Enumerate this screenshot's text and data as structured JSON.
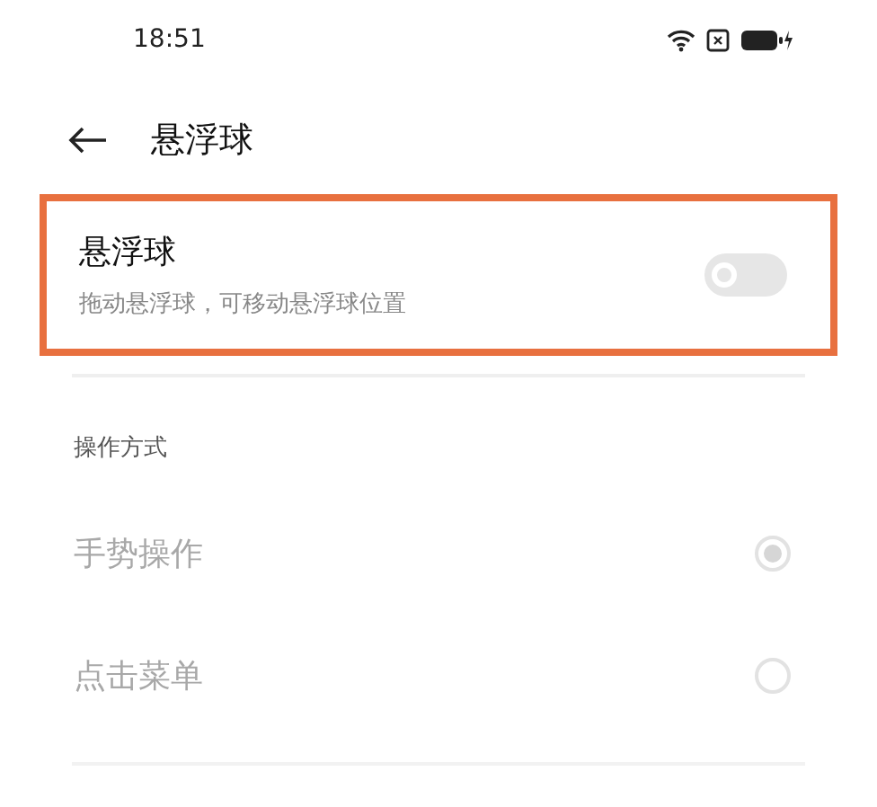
{
  "status_bar": {
    "time": "18:51"
  },
  "header": {
    "title": "悬浮球"
  },
  "floating_ball": {
    "title": "悬浮球",
    "subtitle": "拖动悬浮球，可移动悬浮球位置",
    "on": false,
    "highlighted": true
  },
  "section": {
    "title": "操作方式"
  },
  "options": [
    {
      "label": "手势操作",
      "selected": true,
      "disabled": true
    },
    {
      "label": "点击菜单",
      "selected": false,
      "disabled": true
    }
  ]
}
